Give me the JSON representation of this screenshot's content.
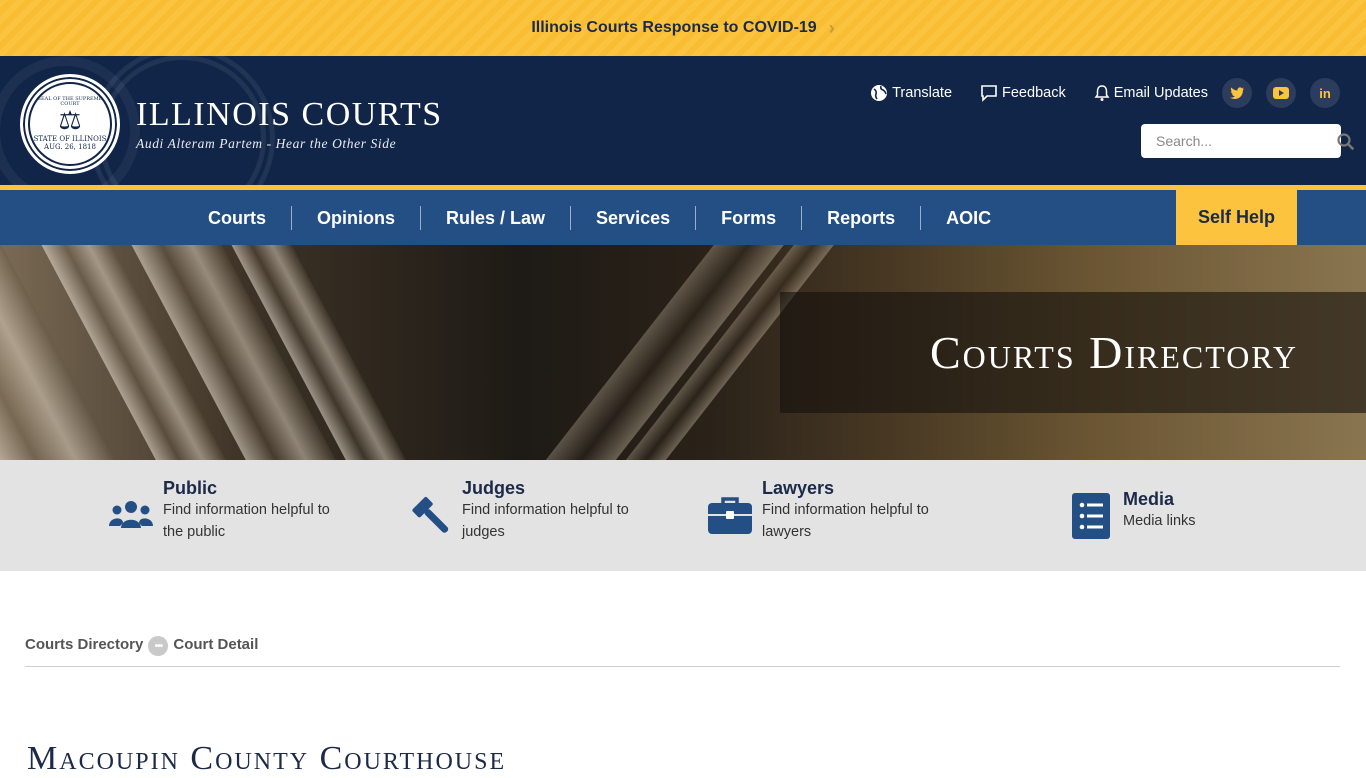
{
  "alert_banner": {
    "text": "Illinois Courts Response to COVID-19",
    "chevron": "›"
  },
  "header": {
    "seal": {
      "line1": "SEAL OF THE SUPREME COURT",
      "line2": "STATE OF ILLINOIS",
      "line3": "AUG. 26, 1818"
    },
    "brand_name": "ILLINOIS COURTS",
    "motto": "Audi Alteram Partem - Hear the Other Side",
    "utility_links": [
      {
        "label": "Translate",
        "icon": "globe-icon"
      },
      {
        "label": "Feedback",
        "icon": "speech-bubble-icon"
      },
      {
        "label": "Email Updates",
        "icon": "bell-icon"
      }
    ],
    "social": [
      {
        "name": "twitter",
        "icon": "twitter-icon",
        "glyph": "t"
      },
      {
        "name": "youtube",
        "icon": "youtube-icon",
        "glyph": "▶"
      },
      {
        "name": "linkedin",
        "icon": "linkedin-icon",
        "glyph": "in"
      }
    ],
    "search": {
      "placeholder": "Search...",
      "value": ""
    }
  },
  "nav": {
    "items": [
      "Courts",
      "Opinions",
      "Rules / Law",
      "Services",
      "Forms",
      "Reports",
      "AOIC"
    ],
    "self_help": "Self Help"
  },
  "hero": {
    "title": "Courts Directory"
  },
  "audience": [
    {
      "title": "Public",
      "desc": "Find information helpful to the public",
      "icon": "people-icon"
    },
    {
      "title": "Judges",
      "desc": "Find information helpful to judges",
      "icon": "gavel-icon"
    },
    {
      "title": "Lawyers",
      "desc": "Find information helpful to lawyers",
      "icon": "briefcase-icon"
    },
    {
      "title": "Media",
      "desc": "Media links",
      "icon": "list-document-icon"
    }
  ],
  "breadcrumb": {
    "items": [
      "Courts Directory",
      "Court Detail"
    ],
    "separator": "•••"
  },
  "page_title": "Macoupin County Courthouse",
  "colors": {
    "banner": "#fcc43e",
    "header": "#112548",
    "nav": "#244f84",
    "accent": "#fcc43e",
    "icon_blue": "#244f84"
  }
}
